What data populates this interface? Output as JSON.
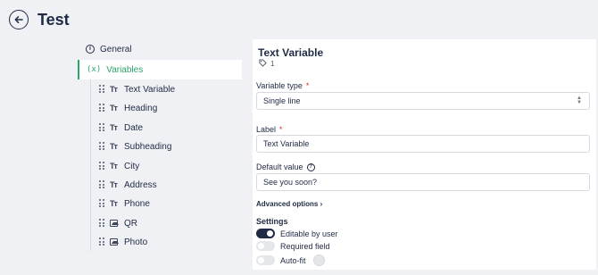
{
  "header": {
    "title": "Test",
    "back_icon": "arrow-left-icon"
  },
  "nav": {
    "general_label": "General",
    "variables_glyph": "(x)",
    "variables_label": "Variables",
    "accent_color": "#2aa66a"
  },
  "variables": [
    {
      "label": "Text Variable",
      "type_icon": "text-type-icon"
    },
    {
      "label": "Heading",
      "type_icon": "text-type-icon"
    },
    {
      "label": "Date",
      "type_icon": "text-type-icon"
    },
    {
      "label": "Subheading",
      "type_icon": "text-type-icon"
    },
    {
      "label": "City",
      "type_icon": "text-type-icon"
    },
    {
      "label": "Address",
      "type_icon": "text-type-icon"
    },
    {
      "label": "Phone",
      "type_icon": "text-type-icon"
    },
    {
      "label": "QR",
      "type_icon": "image-type-icon"
    },
    {
      "label": "Photo",
      "type_icon": "image-type-icon"
    }
  ],
  "tt_glyph": "Tт",
  "panel": {
    "title": "Text Variable",
    "tag_count": "1",
    "variable_type_label": "Variable type",
    "variable_type_value": "Single line",
    "required_mark": "*",
    "label_label": "Label",
    "label_value": "Text Variable",
    "default_value_label": "Default value",
    "default_value_value": "See you soon?",
    "advanced_options": "Advanced options",
    "settings_heading": "Settings",
    "toggles": [
      {
        "label": "Editable by user",
        "on": true
      },
      {
        "label": "Required field",
        "on": false
      },
      {
        "label": "Auto-fit",
        "on": false
      }
    ]
  }
}
